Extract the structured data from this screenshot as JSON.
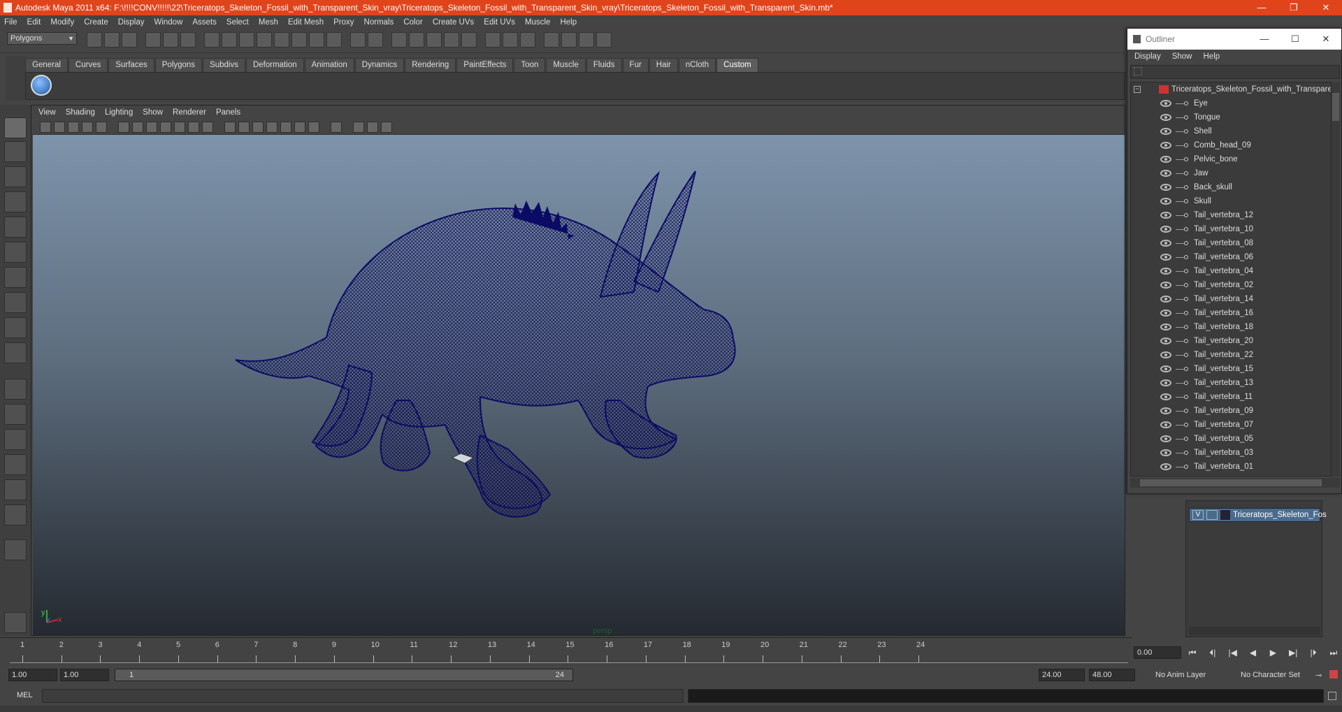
{
  "app": {
    "title": "Autodesk Maya 2011 x64: F:\\!!!!CONV!!!!!\\22\\Triceratops_Skeleton_Fossil_with_Transparent_Skin_vray\\Triceratops_Skeleton_Fossil_with_Transparent_Skin_vray\\Triceratops_Skeleton_Fossil_with_Transparent_Skin.mb*",
    "window_buttons": {
      "minimize": "—",
      "restore": "❐",
      "close": "✕"
    }
  },
  "menubar": [
    "File",
    "Edit",
    "Modify",
    "Create",
    "Display",
    "Window",
    "Assets",
    "Select",
    "Mesh",
    "Edit Mesh",
    "Proxy",
    "Normals",
    "Color",
    "Create UVs",
    "Edit UVs",
    "Muscle",
    "Help"
  ],
  "mode_selector": {
    "value": "Polygons"
  },
  "shelf_tabs": [
    "General",
    "Curves",
    "Surfaces",
    "Polygons",
    "Subdivs",
    "Deformation",
    "Animation",
    "Dynamics",
    "Rendering",
    "PaintEffects",
    "Toon",
    "Muscle",
    "Fluids",
    "Fur",
    "Hair",
    "nCloth",
    "Custom"
  ],
  "active_shelf_tab": "Custom",
  "viewport": {
    "menu": [
      "View",
      "Shading",
      "Lighting",
      "Show",
      "Renderer",
      "Panels"
    ],
    "camera_label": "persp",
    "axis": {
      "x": "x",
      "y": "y"
    },
    "wire_color": "#0d0d6e"
  },
  "outliner": {
    "title": "Outliner",
    "window_buttons": {
      "minimize": "—",
      "maximize": "☐",
      "close": "✕"
    },
    "menu": [
      "Display",
      "Show",
      "Help"
    ],
    "search_placeholder": "",
    "root": "Triceratops_Skeleton_Fossil_with_Transparent_Skin",
    "items": [
      "Eye",
      "Tongue",
      "Shell",
      "Comb_head_09",
      "Pelvic_bone",
      "Jaw",
      "Back_skull",
      "Skull",
      "Tail_vertebra_12",
      "Tail_vertebra_10",
      "Tail_vertebra_08",
      "Tail_vertebra_06",
      "Tail_vertebra_04",
      "Tail_vertebra_02",
      "Tail_vertebra_14",
      "Tail_vertebra_16",
      "Tail_vertebra_18",
      "Tail_vertebra_20",
      "Tail_vertebra_22",
      "Tail_vertebra_15",
      "Tail_vertebra_13",
      "Tail_vertebra_11",
      "Tail_vertebra_09",
      "Tail_vertebra_07",
      "Tail_vertebra_05",
      "Tail_vertebra_03",
      "Tail_vertebra_01"
    ]
  },
  "layers": {
    "visible_flag": "V",
    "name": "Triceratops_Skeleton_Fos"
  },
  "timeline": {
    "ticks": [
      "1",
      "2",
      "3",
      "4",
      "5",
      "6",
      "7",
      "8",
      "9",
      "10",
      "11",
      "12",
      "13",
      "14",
      "15",
      "16",
      "17",
      "18",
      "19",
      "20",
      "21",
      "22",
      "23",
      "24"
    ],
    "current_time": "0.00"
  },
  "playback": [
    "⏮",
    "⏴|",
    "|◀",
    "◀",
    "▶",
    "▶|",
    "|⏵",
    "⏭"
  ],
  "range": {
    "start_time": "1.00",
    "playback_start": "1.00",
    "slider_start": "1",
    "slider_end": "24",
    "playback_end": "24.00",
    "end_time": "48.00",
    "anim_layer": "No Anim Layer",
    "character_set": "No Character Set"
  },
  "command_line": {
    "label": "MEL"
  }
}
